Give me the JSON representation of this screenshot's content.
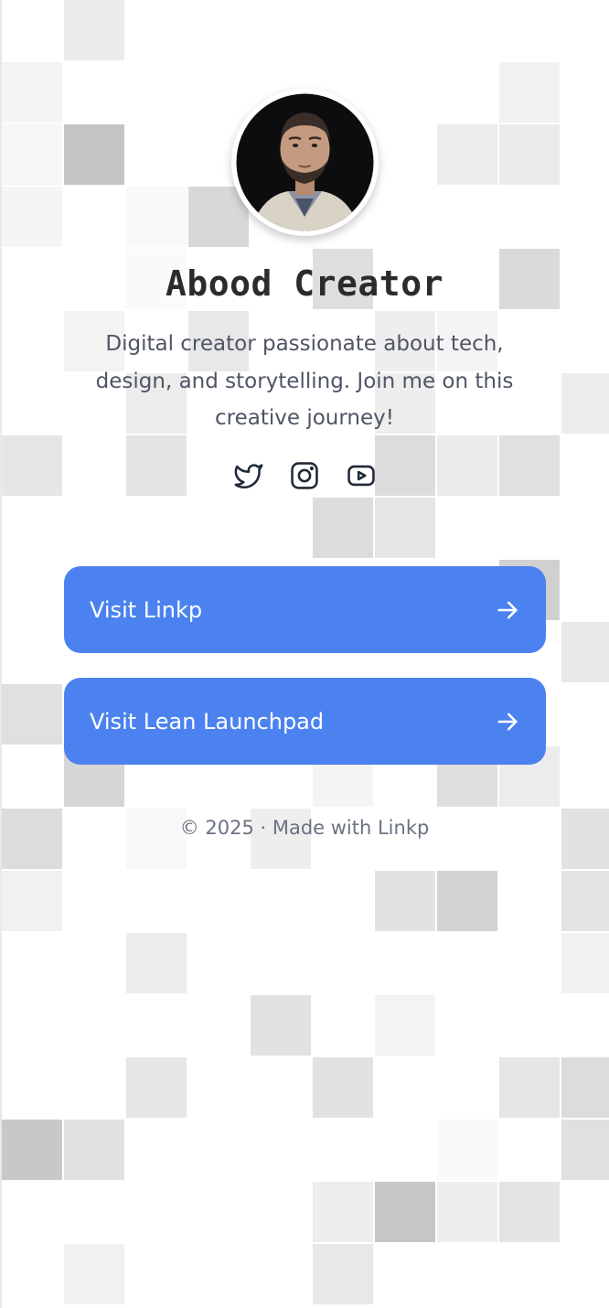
{
  "profile": {
    "name": "Abood Creator",
    "bio": "Digital creator passionate about tech, design, and storytelling. Join me on this creative journey!",
    "avatar_alt": "avatar"
  },
  "socials": [
    {
      "name": "twitter-icon"
    },
    {
      "name": "instagram-icon"
    },
    {
      "name": "youtube-icon"
    }
  ],
  "links": [
    {
      "label": "Visit Linkp"
    },
    {
      "label": "Visit Lean Launchpad"
    }
  ],
  "footer": {
    "text": "© 2025 · Made with Linkp"
  },
  "colors": {
    "button": "#4c82ef",
    "title": "#2b2b2b",
    "body_text": "#4f5564",
    "footer_text": "#6b7282"
  }
}
